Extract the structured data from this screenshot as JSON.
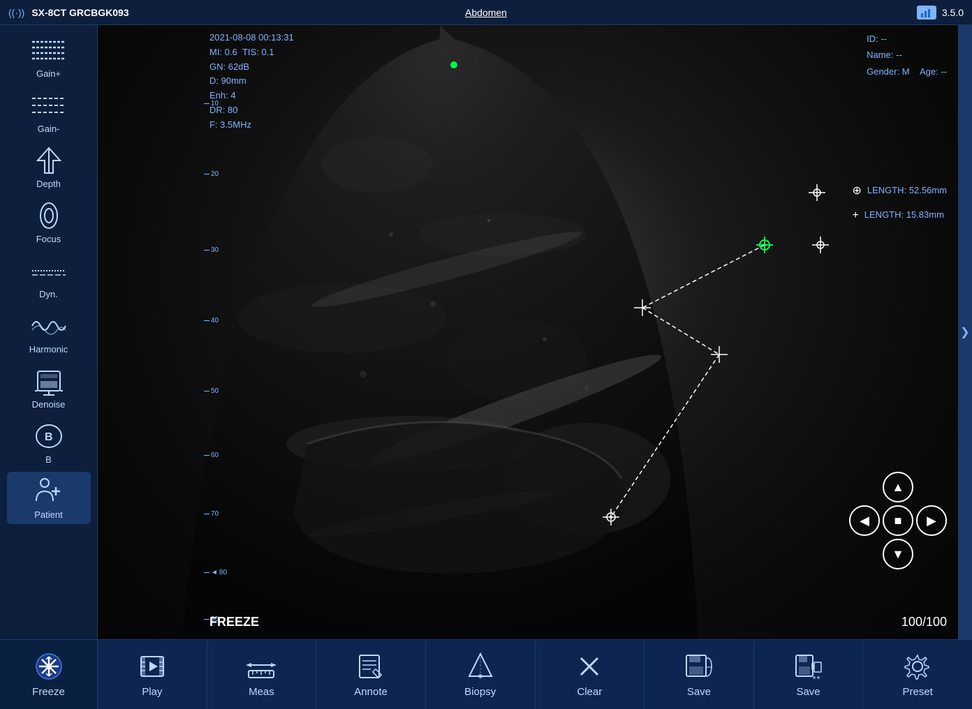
{
  "topbar": {
    "signal_icon": "((·))",
    "device_id": "SX-8CT GRCBGK093",
    "exam_type": "Abdomen",
    "version": "3.5.0"
  },
  "info": {
    "datetime": "2021-08-08 00:13:31",
    "mi": "MI: 0.6",
    "tis": "TIS: 0.1",
    "gn": "GN: 62dB",
    "depth": "D: 90mm",
    "enh": "Enh: 4",
    "dr": "DR: 80",
    "freq": "F: 3.5MHz"
  },
  "patient": {
    "id_label": "ID: --",
    "name_label": "Name: --",
    "gender_label": "Gender: M",
    "age_label": "Age: --"
  },
  "measurements": {
    "meas1_label": "LENGTH: 52.56mm",
    "meas2_label": "LENGTH: 15.83mm"
  },
  "status": {
    "freeze": "FREEZE",
    "frame_counter": "100/100"
  },
  "sidebar": {
    "items": [
      {
        "id": "gain-plus",
        "label": "Gain+"
      },
      {
        "id": "gain-minus",
        "label": "Gain-"
      },
      {
        "id": "depth",
        "label": "Depth"
      },
      {
        "id": "focus",
        "label": "Focus"
      },
      {
        "id": "dyn",
        "label": "Dyn."
      },
      {
        "id": "harmonic",
        "label": "Harmonic"
      },
      {
        "id": "denoise",
        "label": "Denoise"
      },
      {
        "id": "b-mode",
        "label": "B"
      },
      {
        "id": "patient",
        "label": "Patient"
      }
    ]
  },
  "toolbar": {
    "buttons": [
      {
        "id": "freeze",
        "label": "Freeze"
      },
      {
        "id": "play",
        "label": "Play"
      },
      {
        "id": "meas",
        "label": "Meas"
      },
      {
        "id": "annote",
        "label": "Annote"
      },
      {
        "id": "biopsy",
        "label": "Biopsy"
      },
      {
        "id": "clear",
        "label": "Clear"
      },
      {
        "id": "save1",
        "label": "Save"
      },
      {
        "id": "save2",
        "label": "Save"
      },
      {
        "id": "preset",
        "label": "Preset"
      }
    ]
  },
  "depth_marks": [
    "10",
    "20",
    "30",
    "40",
    "50",
    "60",
    "70",
    "80",
    "90"
  ],
  "colors": {
    "accent": "#1a6bb5",
    "background": "#0a1628",
    "sidebar_bg": "#0d1f3c",
    "text_info": "#7fb3ff",
    "toolbar_bg": "#0d2550"
  }
}
